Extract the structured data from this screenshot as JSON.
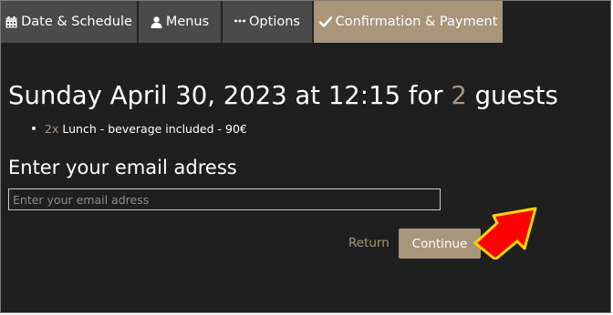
{
  "tabs": [
    {
      "label": "Date & Schedule",
      "icon": "calendar-icon",
      "active": false
    },
    {
      "label": "Menus",
      "icon": "person-icon",
      "active": false
    },
    {
      "label": "Options",
      "icon": "ellipsis-icon",
      "active": false
    },
    {
      "label": "Confirmation & Payment",
      "icon": "checkmark-icon",
      "active": true
    }
  ],
  "booking": {
    "headline_before": "Sunday April 30, 2023 at 12:15 for ",
    "guests": "2",
    "headline_after": " guests"
  },
  "order_items": [
    {
      "qty": "2x",
      "description": "Lunch - beverage included - 90€"
    }
  ],
  "email_section": {
    "heading": "Enter your email adress",
    "placeholder": "Enter your email adress",
    "value": ""
  },
  "actions": {
    "return_label": "Return",
    "continue_label": "Continue"
  },
  "annotation": {
    "arrow_icon": "pointer-arrow-icon",
    "arrow_color": "#ff0000",
    "arrow_outline_color": "#ffd700"
  },
  "colors": {
    "accent": "#a8957a",
    "background": "#1f1f1f",
    "tab_inactive": "#4a4a4a"
  }
}
